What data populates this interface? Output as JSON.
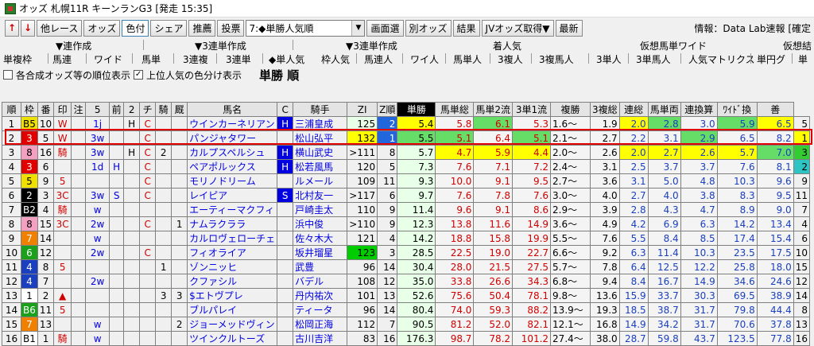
{
  "title": "オッズ 札幌11R キーンランG3 [発走 15:35]",
  "toolbar": {
    "prev": "↑",
    "next": "↓",
    "buttons": [
      "他レース",
      "オッズ",
      "色付",
      "シェア",
      "推薦",
      "投票"
    ],
    "combo": "7:◆単勝人気順",
    "buttons2": [
      "画面選",
      "別オッズ",
      "結果",
      "JVオッズ取得▼",
      "最新"
    ],
    "info": "情報：Data Lab速報 [確定"
  },
  "menu1": [
    "▼連作成",
    "▼3連単作成",
    "▼3連単作成",
    "着人気",
    "仮想馬単ワイド",
    "仮想結"
  ],
  "menu2": [
    "単複枠",
    "馬連",
    "ワイド",
    "馬単",
    "3連複",
    "3連単",
    "◆単人気",
    "枠人気",
    "馬連人",
    "ワイ人",
    "馬単人",
    "3複人",
    "3複馬人",
    "3単人",
    "3単馬人",
    "人気マトリクス",
    "単円グ",
    "単"
  ],
  "options": {
    "opt1": "各合成オッズ等の順位表示",
    "opt2": "上位人気の色分け表示",
    "opt2_checked": "✓",
    "heading": "単勝 順"
  },
  "columns": [
    "順",
    "枠",
    "番",
    "印",
    "注",
    "5",
    "前",
    "2",
    "チ",
    "騎",
    "厩",
    "馬名",
    "C",
    "騎手",
    "ZI",
    "Z順",
    "単勝",
    "馬単総",
    "馬単2流",
    "3単1流",
    "複勝",
    "3複総",
    "連総",
    "馬単両",
    "連換算",
    "ﾜｲﾄﾞ換",
    "善"
  ],
  "rows": [
    [
      "1",
      "B5",
      "10",
      "W",
      "",
      "1j",
      "",
      "H",
      "C",
      "",
      "",
      "ウインカーネリアン",
      "H",
      "三浦皇成",
      "125",
      "2",
      "5.4",
      "5.8",
      "6.1",
      "5.3",
      "1.6〜",
      "1.9",
      "2.0",
      "2.8",
      "3.0",
      "5.9",
      "6.5",
      "5"
    ],
    [
      "2",
      "3",
      "5",
      "W",
      "",
      "3w",
      "",
      "",
      "C",
      "",
      "",
      "パンジャタワー",
      "",
      "松山弘平",
      "132",
      "1",
      "5.5",
      "5.1",
      "6.4",
      "5.1",
      "2.1〜",
      "2.7",
      "2.2",
      "3.1",
      "2.9",
      "6.5",
      "8.2",
      "1"
    ],
    [
      "3",
      "8",
      "16",
      "騎",
      "",
      "3w",
      "",
      "H",
      "C",
      "2",
      "",
      "カルプスペルシュ",
      "H",
      "横山武史",
      ">111",
      "8",
      "5.7",
      "4.7",
      "5.9",
      "4.4",
      "2.0〜",
      "2.6",
      "2.0",
      "2.7",
      "2.6",
      "5.7",
      "7.0",
      "3"
    ],
    [
      "4",
      "3",
      "6",
      "",
      "",
      "1d",
      "H",
      "",
      "C",
      "",
      "",
      "ペアポルックス",
      "H",
      "松若風馬",
      "120",
      "5",
      "7.3",
      "7.6",
      "7.1",
      "7.2",
      "2.4〜",
      "3.1",
      "2.5",
      "3.7",
      "3.7",
      "7.6",
      "8.1",
      "2"
    ],
    [
      "5",
      "5",
      "9",
      "5",
      "",
      "",
      "",
      "",
      "C",
      "",
      "",
      "モリノドリーム",
      "",
      "ルメール",
      "109",
      "11",
      "9.3",
      "10.0",
      "9.1",
      "9.5",
      "2.7〜",
      "3.6",
      "3.1",
      "5.0",
      "4.8",
      "10.3",
      "9.6",
      "9"
    ],
    [
      "6",
      "2",
      "3",
      "3C",
      "",
      "3w",
      "S",
      "",
      "C",
      "",
      "",
      "レイピア",
      "S",
      "北村友一",
      ">117",
      "6",
      "9.7",
      "7.6",
      "7.8",
      "7.6",
      "3.0〜",
      "4.0",
      "2.7",
      "4.0",
      "3.8",
      "8.3",
      "9.5",
      "11"
    ],
    [
      "7",
      "B2",
      "4",
      "騎",
      "",
      "w",
      "",
      "",
      "",
      "",
      "",
      "エーティーマクフィ",
      "",
      "戸崎圭太",
      "110",
      "9",
      "11.4",
      "9.6",
      "9.1",
      "8.6",
      "2.9〜",
      "3.9",
      "2.8",
      "4.3",
      "4.7",
      "8.9",
      "9.0",
      "7"
    ],
    [
      "8",
      "8",
      "15",
      "3C",
      "",
      "2w",
      "",
      "",
      "C",
      "",
      "1",
      "ナムラクララ",
      "",
      "浜中俊",
      ">110",
      "9",
      "12.3",
      "13.8",
      "11.6",
      "14.9",
      "3.6〜",
      "4.9",
      "4.2",
      "6.9",
      "6.3",
      "14.2",
      "13.4",
      "4"
    ],
    [
      "9",
      "7",
      "14",
      "",
      "",
      "w",
      "",
      "",
      "",
      "",
      "",
      "カルロヴェローチェ",
      "",
      "佐々木大",
      "121",
      "4",
      "14.2",
      "18.8",
      "15.8",
      "19.9",
      "5.5〜",
      "7.6",
      "5.5",
      "8.4",
      "8.5",
      "17.4",
      "15.4",
      "6"
    ],
    [
      "10",
      "6",
      "12",
      "",
      "",
      "2w",
      "",
      "",
      "C",
      "",
      "",
      "フィオライア",
      "",
      "坂井瑠星",
      "123",
      "3",
      "28.5",
      "22.5",
      "19.0",
      "22.7",
      "6.6〜",
      "9.2",
      "6.3",
      "11.4",
      "10.3",
      "23.5",
      "17.5",
      "10"
    ],
    [
      "11",
      "4",
      "8",
      "5",
      "",
      "",
      "",
      "",
      "",
      "1",
      "",
      "ゾンニッヒ",
      "",
      "武豊",
      "96",
      "14",
      "30.4",
      "28.0",
      "21.5",
      "27.5",
      "5.7〜",
      "7.8",
      "6.4",
      "12.5",
      "12.2",
      "25.8",
      "18.0",
      "15"
    ],
    [
      "12",
      "4",
      "7",
      "",
      "",
      "2w",
      "",
      "",
      "",
      "",
      "",
      "クファシル",
      "",
      "バデル",
      "108",
      "12",
      "35.0",
      "33.8",
      "26.6",
      "34.3",
      "6.8〜",
      "9.4",
      "8.4",
      "16.7",
      "14.9",
      "34.6",
      "24.6",
      "12"
    ],
    [
      "13",
      "1",
      "2",
      "▲",
      "",
      "",
      "",
      "",
      "",
      "3",
      "3",
      "$エトヴプレ",
      "",
      "丹内祐次",
      "101",
      "13",
      "52.6",
      "75.6",
      "50.4",
      "78.1",
      "9.8〜",
      "13.6",
      "15.9",
      "33.7",
      "30.3",
      "69.5",
      "38.9",
      "14"
    ],
    [
      "14",
      "B6",
      "11",
      "5",
      "",
      "",
      "",
      "",
      "",
      "",
      "",
      "ブルパレイ",
      "",
      "ティータ",
      "96",
      "14",
      "80.4",
      "74.0",
      "59.3",
      "88.2",
      "13.9〜",
      "19.3",
      "18.5",
      "38.7",
      "31.7",
      "79.8",
      "44.4",
      "8"
    ],
    [
      "15",
      "7",
      "13",
      "",
      "",
      "w",
      "",
      "",
      "",
      "",
      "2",
      "ジョーメッドヴィン",
      "",
      "松岡正海",
      "112",
      "7",
      "90.5",
      "81.2",
      "52.0",
      "82.1",
      "12.1〜",
      "16.8",
      "14.9",
      "34.2",
      "31.7",
      "70.6",
      "37.8",
      "13"
    ],
    [
      "16",
      "B1",
      "1",
      "騎",
      "",
      "w",
      "",
      "",
      "",
      "",
      "",
      "ツインクルトーズ",
      "",
      "古川吉洋",
      "83",
      "16",
      "176.3",
      "98.7",
      "78.2",
      "101.2",
      "27.4〜",
      "38.0",
      "28.7",
      "59.8",
      "43.7",
      "123.5",
      "77.8",
      "16"
    ]
  ],
  "colors": {
    "highlight_frame": "#e00000",
    "rank1": "#ffff00",
    "rank2": "#33cc33",
    "zi_top": "#00cc00"
  }
}
